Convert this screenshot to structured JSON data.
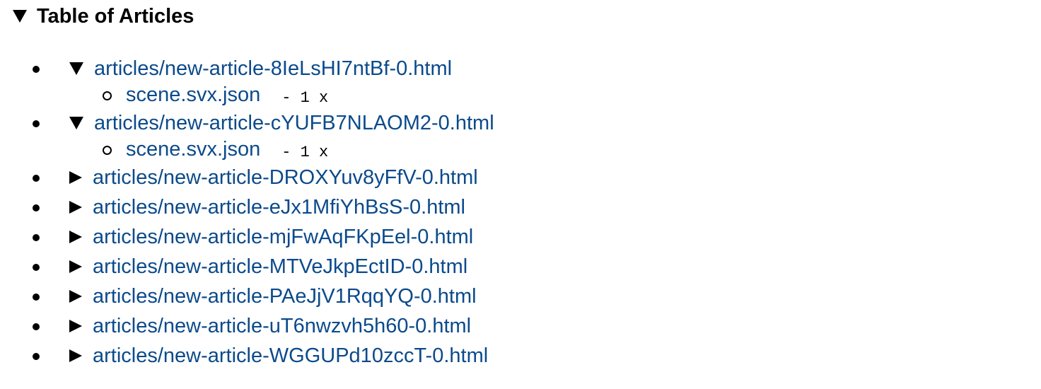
{
  "toc": {
    "title": "Table of Articles",
    "articles": [
      {
        "link": "articles/new-article-8IeLsHI7ntBf-0.html",
        "expanded": true,
        "children": [
          {
            "link": "scene.svx.json",
            "meta": "- 1 x"
          }
        ]
      },
      {
        "link": "articles/new-article-cYUFB7NLAOM2-0.html",
        "expanded": true,
        "children": [
          {
            "link": "scene.svx.json",
            "meta": "- 1 x"
          }
        ]
      },
      {
        "link": "articles/new-article-DROXYuv8yFfV-0.html",
        "expanded": false,
        "children": []
      },
      {
        "link": "articles/new-article-eJx1MfiYhBsS-0.html",
        "expanded": false,
        "children": []
      },
      {
        "link": "articles/new-article-mjFwAqFKpEel-0.html",
        "expanded": false,
        "children": []
      },
      {
        "link": "articles/new-article-MTVeJkpEctID-0.html",
        "expanded": false,
        "children": []
      },
      {
        "link": "articles/new-article-PAeJjV1RqqYQ-0.html",
        "expanded": false,
        "children": []
      },
      {
        "link": "articles/new-article-uT6nwzvh5h60-0.html",
        "expanded": false,
        "children": []
      },
      {
        "link": "articles/new-article-WGGUPd10zccT-0.html",
        "expanded": false,
        "children": []
      }
    ]
  },
  "colors": {
    "link": "#0b4a8b",
    "text": "#000000",
    "background": "#ffffff"
  },
  "icons": {
    "expanded": "triangle-down-icon",
    "collapsed": "triangle-right-icon"
  }
}
